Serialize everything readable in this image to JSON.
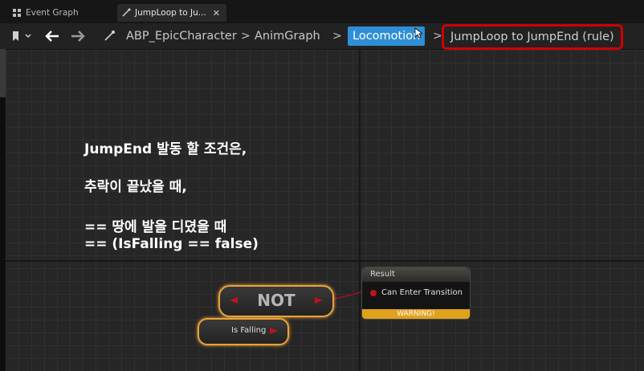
{
  "tabs": [
    {
      "label": "Event Graph",
      "icon": "graph-icon"
    },
    {
      "label": "JumpLoop to Ju...",
      "icon": "transition-icon",
      "close": "✕"
    }
  ],
  "toolbar": {
    "breadcrumbs": [
      "ABP_EpicCharacter",
      "AnimGraph",
      "Locomotion",
      "JumpLoop to JumpEnd (rule)"
    ],
    "separator": ">"
  },
  "annotation": {
    "line1": "JumpEnd 발동 할 조건은,",
    "line2": "추락이 끝났을 때,",
    "line3": "== 땅에 발을 디뎠을 때",
    "line4": "== (IsFalling == false)"
  },
  "nodes": {
    "not_label": "NOT",
    "isfalling_label": "Is Falling",
    "result_header": "Result",
    "result_pin": "Can Enter Transition",
    "result_warning": "WARNING!"
  },
  "colors": {
    "accent": "#2f8fd6",
    "highlight_border": "#d00000",
    "node_border": "#e9a23a",
    "pin_color": "#c1121f",
    "warning": "#e0a21d"
  }
}
